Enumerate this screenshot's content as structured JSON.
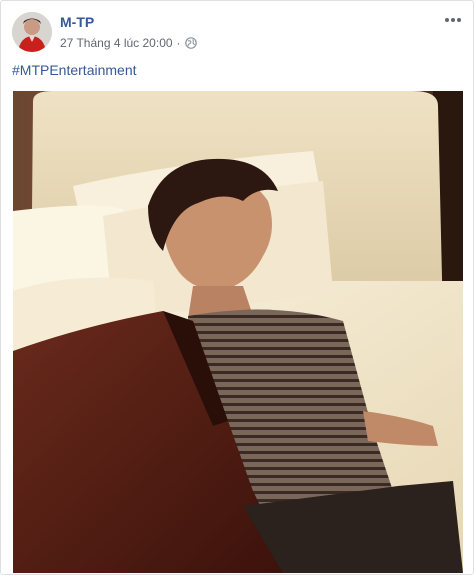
{
  "post": {
    "author": "M-TP",
    "timestamp": "27 Tháng 4 lúc 20:00",
    "separator": "·",
    "privacy_icon": "globe-icon",
    "more_icon": "more-icon",
    "text": "#MTPEntertainment"
  },
  "colors": {
    "link": "#365899",
    "meta": "#616770",
    "border": "#dddfe2"
  },
  "photo": {
    "subject": "photo"
  }
}
